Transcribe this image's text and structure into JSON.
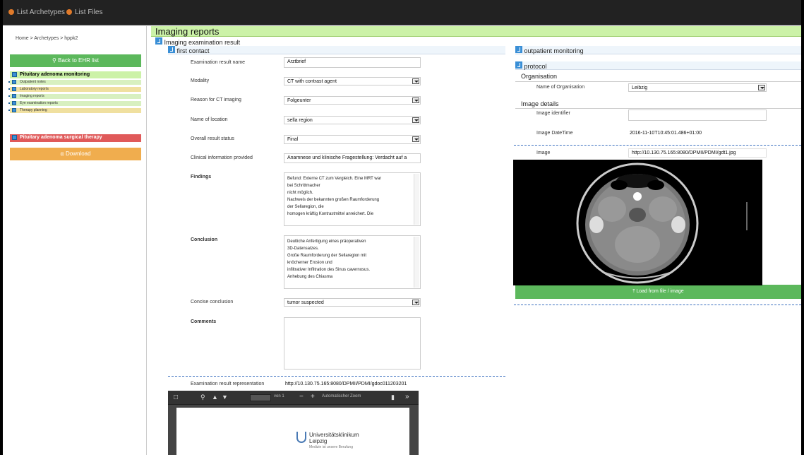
{
  "topbar": {
    "items": [
      "List Archetypes",
      "List Files"
    ]
  },
  "sidebar": {
    "breadcrumb": "Home  >  Archetypes  >  hppk2",
    "back_button": "Back to EHR list",
    "group1": "Pituitary adenoma monitoring",
    "group1_items": [
      "Outpatient notes",
      "Laboratory reports",
      "Imaging reports",
      "Eye examination reports",
      "Therapy planning"
    ],
    "group2": "Pituitary adenoma surgical therapy",
    "download_button": "Download"
  },
  "main": {
    "title": "Imaging reports",
    "section": "Imaging examination result",
    "left_tab": "first contact",
    "right_tab1": "outpatient monitoring",
    "right_tab2": "protocol",
    "fields": {
      "exam_name_label": "Examination result name",
      "exam_name_value": "Arztbrief",
      "modality_label": "Modality",
      "modality_value": "CT with contrast agent",
      "reason_label": "Reason for CT imaging",
      "reason_value": "Folgeunter",
      "location_label": "Name of location",
      "location_value": "sella region",
      "status_label": "Overall result status",
      "status_value": "Final",
      "clinical_label": "Clinical information provided",
      "clinical_value": "Anamnese und klinische Fragestellung: Verdacht auf a",
      "findings_label": "Findings",
      "findings_value": "Befund: Externe CT zum Vergleich. Eine MRT war\nbei Schrittmacher\nnicht möglich.\nNachweis der bekannten großen Raumforderung\nder Sellaregion, die\nhomogen kräftig Kontrastmittel anreichert. Die",
      "conclusion_label": "Conclusion",
      "conclusion_value": "Deutliche Anfertigung eines präoperativen\n3D-Datensatzes.\nGroße Raumforderung der Sellaregion mit\nknöcherner Erosion und\ninfiltrativer Infiltration des Sinus cavernosus.\nAnhebung des Chiasma",
      "concise_label": "Concise conclusion",
      "concise_value": "tumor suspected",
      "comments_label": "Comments",
      "representation_label": "Examination result representation",
      "representation_value": "http://10.130.75.165:8080/DPMII/PDMI/gdoc011203201"
    },
    "right": {
      "organisation_head": "Organisation",
      "org_label": "Name of Organisation",
      "org_value": "Leibzig",
      "image_details_head": "Image details",
      "image_id_label": "Image identifier",
      "image_dt_label": "Image DateTime",
      "image_dt_value": "2016-11-10T10:45:01.486+01:00",
      "image_label": "Image",
      "image_value": "http://10.130.75.165:8080/DPMII/PDMI/gdt1.jpg",
      "upload_button": "Load from file / image"
    },
    "pdf": {
      "zoom": "Automatischer Zoom",
      "page_count": "von 1",
      "logo_text1": "Universitätsklinikum",
      "logo_text2": "Leipzig",
      "logo_text3": "Medizin ist unsere Berufung"
    }
  },
  "colors": {
    "green_button": "#5cb85c",
    "orange_button": "#f0ad4e",
    "green_header": "#ccf2a8",
    "blue_icon": "#3a8fd6",
    "red_group": "#e05a5a"
  }
}
